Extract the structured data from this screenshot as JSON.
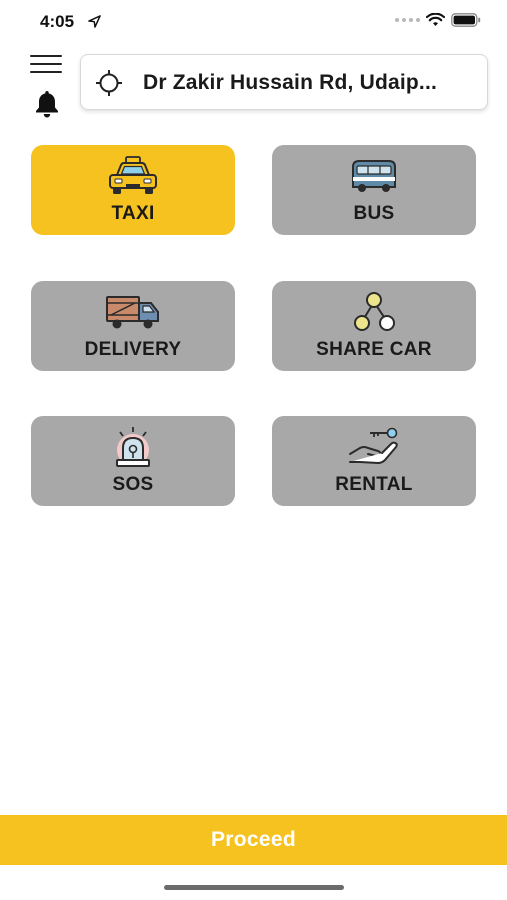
{
  "status_bar": {
    "time": "4:05",
    "location_icon": "location-arrow-icon",
    "wifi_icon": "wifi-icon",
    "battery_icon": "battery-icon"
  },
  "header": {
    "menu_icon": "hamburger-menu-icon",
    "notification_icon": "bell-icon",
    "location": {
      "icon": "crosshair-icon",
      "text": "Dr Zakir Hussain Rd, Udaip..."
    }
  },
  "services": [
    {
      "label": "TAXI",
      "icon": "taxi-icon",
      "selected": true
    },
    {
      "label": "BUS",
      "icon": "bus-icon",
      "selected": false
    },
    {
      "label": "DELIVERY",
      "icon": "delivery-truck-icon",
      "selected": false
    },
    {
      "label": "SHARE CAR",
      "icon": "share-nodes-icon",
      "selected": false
    },
    {
      "label": "SOS",
      "icon": "siren-icon",
      "selected": false
    },
    {
      "label": "RENTAL",
      "icon": "hand-key-icon",
      "selected": false
    }
  ],
  "footer": {
    "proceed_label": "Proceed"
  },
  "colors": {
    "accent": "#f5c21f",
    "tile_inactive": "#a8a8a8",
    "text_dark": "#1a1a1a"
  }
}
